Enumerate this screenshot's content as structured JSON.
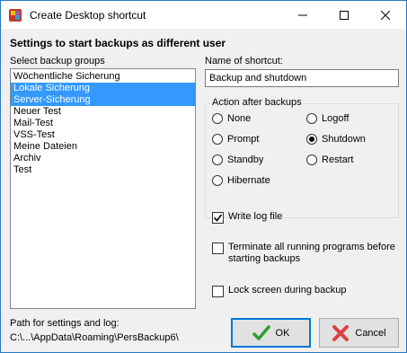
{
  "window": {
    "title": "Create Desktop shortcut"
  },
  "heading": "Settings to start backups as different user",
  "groups": {
    "label": "Select backup groups",
    "items": [
      {
        "label": "Wöchentliche Sicherung",
        "selected": false
      },
      {
        "label": "Lokale Sicherung",
        "selected": true
      },
      {
        "label": "Server-Sicherung",
        "selected": true
      },
      {
        "label": "Neuer Test",
        "selected": false
      },
      {
        "label": "Mail-Test",
        "selected": false
      },
      {
        "label": "VSS-Test",
        "selected": false
      },
      {
        "label": "Meine Dateien",
        "selected": false
      },
      {
        "label": "Archiv",
        "selected": false
      },
      {
        "label": "Test",
        "selected": false
      }
    ]
  },
  "shortcut": {
    "label": "Name of shortcut:",
    "value": "Backup and shutdown"
  },
  "action": {
    "title": "Action after backups",
    "options": [
      {
        "label": "None",
        "checked": false
      },
      {
        "label": "Logoff",
        "checked": false
      },
      {
        "label": "Prompt",
        "checked": false
      },
      {
        "label": "Shutdown",
        "checked": true
      },
      {
        "label": "Standby",
        "checked": false
      },
      {
        "label": "Restart",
        "checked": false
      },
      {
        "label": "Hibernate",
        "checked": false
      }
    ]
  },
  "options": {
    "write_log": {
      "label": "Write log file",
      "checked": true
    },
    "terminate": {
      "label_line1": "Terminate all running programs before",
      "label_line2": "starting backups",
      "checked": false
    },
    "lock_screen": {
      "label": "Lock screen during backup",
      "checked": false
    }
  },
  "path": {
    "label": "Path for settings and log:",
    "value": "C:\\...\\AppData\\Roaming\\PersBackup6\\"
  },
  "buttons": {
    "ok": "OK",
    "cancel": "Cancel"
  },
  "colors": {
    "selection": "#3399ff",
    "title_border": "#2b79c2",
    "default_button_border": "#0078d7",
    "ok_icon": "#2e9c2e",
    "cancel_icon": "#d9433f"
  },
  "icons": {
    "app": "app-icon",
    "minimize": "minimize-icon",
    "maximize": "maximize-icon",
    "close": "close-icon",
    "ok": "checkmark-icon",
    "cancel": "x-mark-icon"
  }
}
